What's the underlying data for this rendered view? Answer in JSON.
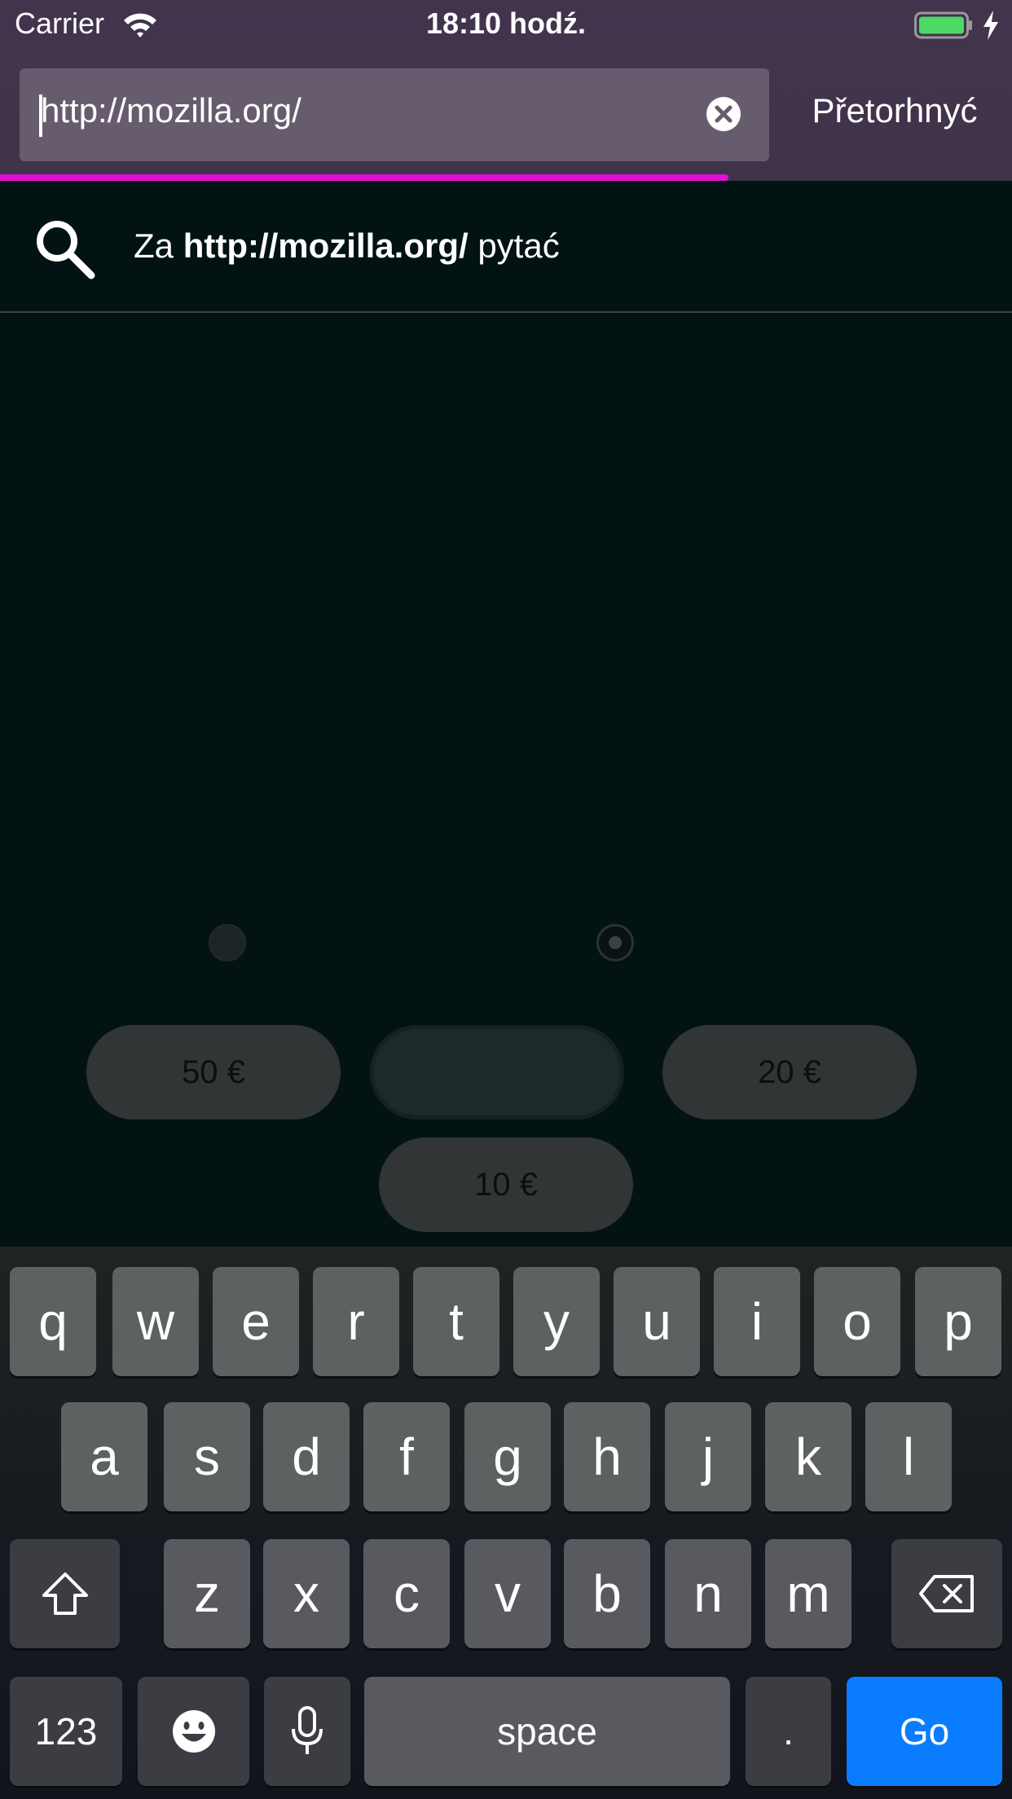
{
  "status": {
    "carrier": "Carrier",
    "time": "18:10 hodź."
  },
  "urlbar": {
    "value": "http://mozilla.org/",
    "cancel_label": "Přetorhnyć",
    "load_progress": 0.72
  },
  "suggestion": {
    "prefix": "Za",
    "query": "http://mozilla.org/",
    "suffix": "pytać"
  },
  "page": {
    "amounts": [
      "50 €",
      "",
      "20 €",
      "10 €"
    ]
  },
  "keyboard": {
    "row1": [
      "q",
      "w",
      "e",
      "r",
      "t",
      "y",
      "u",
      "i",
      "o",
      "p"
    ],
    "row2": [
      "a",
      "s",
      "d",
      "f",
      "g",
      "h",
      "j",
      "k",
      "l"
    ],
    "row3": [
      "z",
      "x",
      "c",
      "v",
      "b",
      "n",
      "m"
    ],
    "numbers_label": "123",
    "space_label": "space",
    "period_label": ".",
    "go_label": "Go"
  },
  "colors": {
    "progress": "#e20ed6",
    "go_key": "#0a7cff",
    "battery": "#4cd964"
  }
}
